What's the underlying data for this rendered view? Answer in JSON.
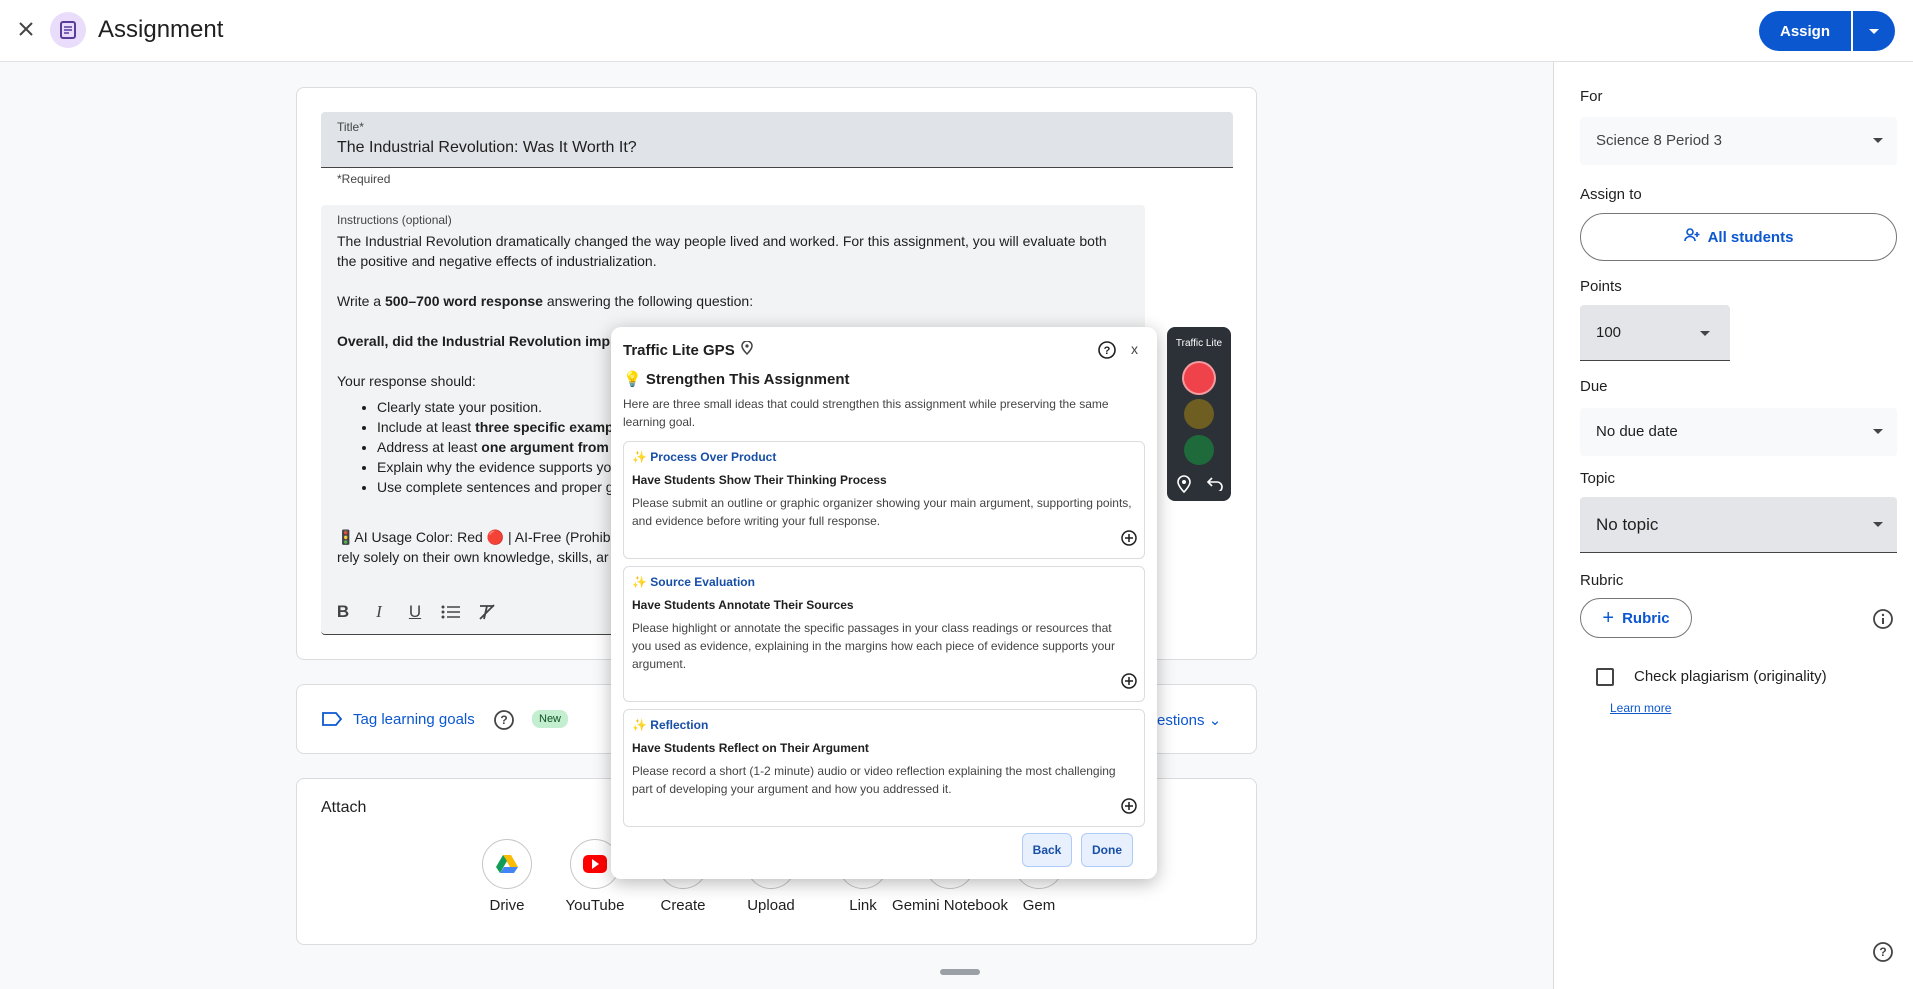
{
  "header": {
    "title": "Assignment",
    "assign_label": "Assign"
  },
  "form": {
    "title_label": "Title*",
    "title_value": "The Industrial Revolution: Was It Worth It?",
    "required_note": "*Required",
    "instructions_label": "Instructions (optional)",
    "para1": "The Industrial Revolution dramatically changed the way people lived and worked. For this assignment, you will evaluate both the positive and negative effects of industrialization.",
    "para2_pre": "Write a ",
    "para2_bold": "500–700 word response",
    "para2_post": " answering the following question:",
    "para3_bold": "Overall, did the Industrial Revolution impro",
    "para4": "Your response should:",
    "bullets": {
      "b1": "Clearly state your position.",
      "b2_pre": "Include at least ",
      "b2_bold": "three specific examp",
      "b3_pre": "Address at least ",
      "b3_bold": "one argument from",
      "b4": "Explain why the evidence supports yo",
      "b5": "Use complete sentences and proper g"
    },
    "ai_line1": "🚦AI Usage Color: Red 🔴 | AI-Free (Prohibi",
    "ai_line2": "rely solely on their own knowledge, skills, ar"
  },
  "tags": {
    "label": "Tag learning goals",
    "new_badge": "New",
    "questions_link": "estions"
  },
  "attach": {
    "title": "Attach",
    "items": {
      "drive": "Drive",
      "youtube": "YouTube",
      "create": "Create",
      "upload": "Upload",
      "link": "Link",
      "gemini": "Gemini Notebook",
      "gem": "Gem"
    }
  },
  "side": {
    "for_label": "For",
    "for_value": "Science 8 Period 3",
    "assign_to_label": "Assign to",
    "assign_to_value": "All students",
    "points_label": "Points",
    "points_value": "100",
    "due_label": "Due",
    "due_value": "No due date",
    "topic_label": "Topic",
    "topic_value": "No topic",
    "rubric_label": "Rubric",
    "rubric_button": "Rubric",
    "plagiarism_label": "Check plagiarism (originality)",
    "learn_more": "Learn more"
  },
  "popup": {
    "title": "Traffic Lite GPS",
    "close": "x",
    "heading": "💡 Strengthen This Assignment",
    "intro": "Here are three small ideas that could strengthen this assignment while preserving the same learning goal.",
    "ideas": [
      {
        "tag": "✨ Process Over Product",
        "title": "Have Students Show Their Thinking Process",
        "desc": "Please submit an outline or graphic organizer showing your main argument, supporting points, and evidence before writing your full response."
      },
      {
        "tag": "✨ Source Evaluation",
        "title": "Have Students Annotate Their Sources",
        "desc": "Please highlight or annotate the specific passages in your class readings or resources that you used as evidence, explaining in the margins how each piece of evidence supports your argument."
      },
      {
        "tag": "✨ Reflection",
        "title": "Have Students Reflect on Their Argument",
        "desc": "Please record a short (1-2 minute) audio or video reflection explaining the most challenging part of developing your argument and how you addressed it."
      }
    ],
    "back": "Back",
    "done": "Done"
  },
  "traffic_widget": {
    "title": "Traffic Lite",
    "active_light": "red"
  },
  "colors": {
    "primary": "#0b57d0",
    "red_light": "#f0424b"
  }
}
